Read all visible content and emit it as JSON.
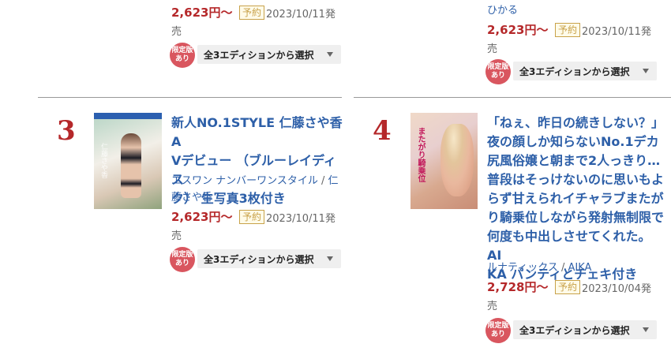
{
  "common": {
    "currency_suffix": "円〜",
    "reserve_label": "予約",
    "hatsubai": "発",
    "hatsubai_tail": "売",
    "badge_line1": "限定版",
    "badge_line2": "あり",
    "edition_select": "全3エディションから選択"
  },
  "top_left": {
    "price": "2,623円〜",
    "date": "2023/10/11"
  },
  "top_right": {
    "maker": "ひかる",
    "price": "2,623円〜",
    "date": "2023/10/11"
  },
  "item3": {
    "rank": "3",
    "title_lines": [
      "新人NO.1STYLE 仁藤さや香A",
      "Vデビュー （ブルーレイディス",
      "ク） 生写真3枚付き"
    ],
    "maker_line1": "エスワン ナンバーワンスタイル",
    "maker_sep": "/",
    "maker_line1_tail": "仁",
    "maker_line2": "藤さや香",
    "price": "2,623円〜",
    "date": "2023/10/11",
    "thumb_text": "仁藤さや香"
  },
  "item4": {
    "rank": "4",
    "title_lines": [
      "「ねぇ、昨日の続きしない？」",
      "夜の顔しか知らないNo.1デカ",
      "尻風俗嬢と朝まで2人っきり…",
      "普段はそっけないのに思いもよ",
      "らず甘えられイチャラブまたが",
      "り騎乗位しながら発射無制限で",
      "何度も中出しさせてくれた。 AI",
      "KA パンティとチェキ付き"
    ],
    "maker": "ルナティックス",
    "maker_sep": "/",
    "actress": "AIKA",
    "price": "2,728円〜",
    "date": "2023/10/04",
    "thumb_text": "またがり騎乗位"
  }
}
